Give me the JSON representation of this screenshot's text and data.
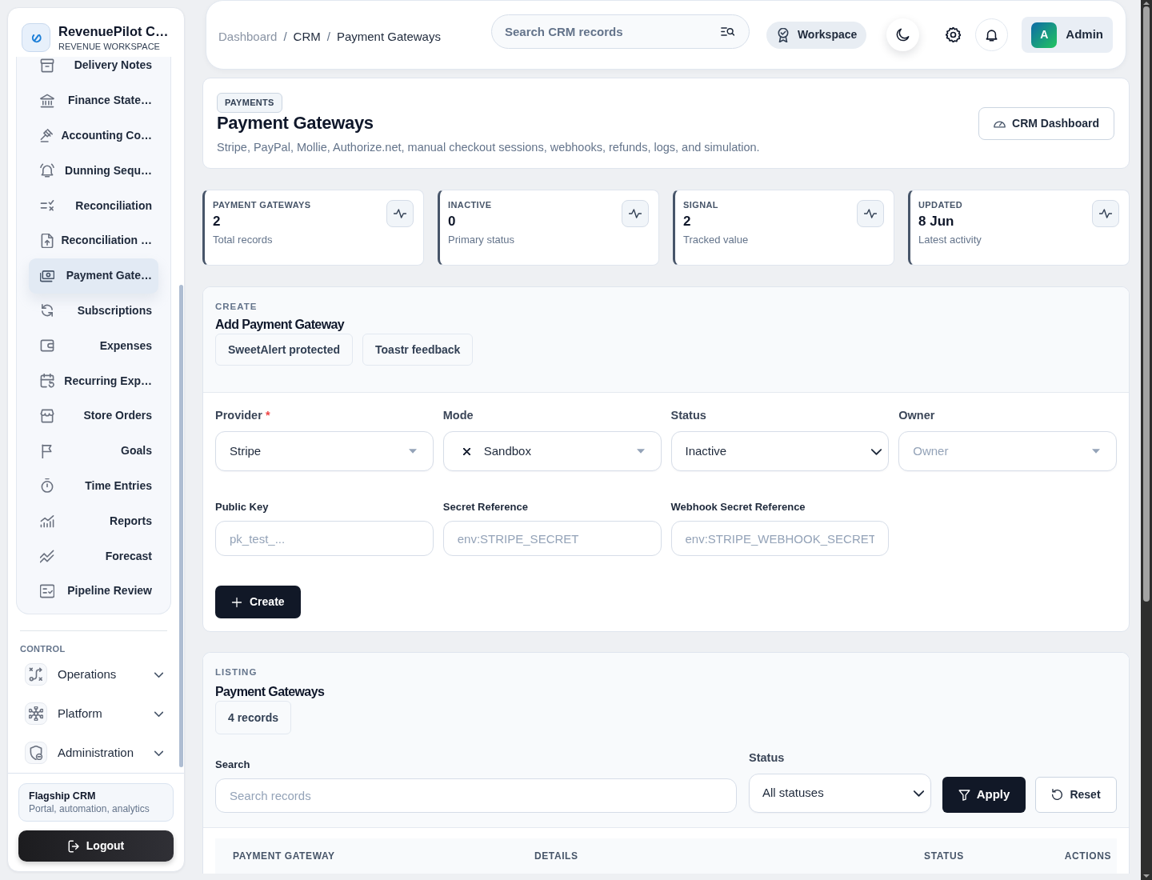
{
  "sidebar": {
    "brand": {
      "title": "RevenuePilot C…",
      "subtitle": "REVENUE WORKSPACE"
    },
    "nav_items": [
      {
        "label": "Delivery Notes",
        "selected": false
      },
      {
        "label": "Finance State…",
        "selected": false
      },
      {
        "label": "Accounting Co…",
        "selected": false
      },
      {
        "label": "Dunning Sequ…",
        "selected": false
      },
      {
        "label": "Reconciliation",
        "selected": false
      },
      {
        "label": "Reconciliation …",
        "selected": false
      },
      {
        "label": "Payment Gate…",
        "selected": true
      },
      {
        "label": "Subscriptions",
        "selected": false
      },
      {
        "label": "Expenses",
        "selected": false
      },
      {
        "label": "Recurring Exp…",
        "selected": false
      },
      {
        "label": "Store Orders",
        "selected": false
      },
      {
        "label": "Goals",
        "selected": false
      },
      {
        "label": "Time Entries",
        "selected": false
      },
      {
        "label": "Reports",
        "selected": false
      },
      {
        "label": "Forecast",
        "selected": false
      },
      {
        "label": "Pipeline Review",
        "selected": false
      }
    ],
    "section_label": "CONTROL",
    "groups": [
      {
        "label": "Operations",
        "expanded": false
      },
      {
        "label": "Platform",
        "expanded": false
      },
      {
        "label": "Administration",
        "expanded": false
      }
    ],
    "footer_card": {
      "title": "Flagship CRM",
      "subtitle": "Portal, automation, analytics"
    },
    "logout": "Logout"
  },
  "topbar": {
    "breadcrumbs": [
      {
        "label": "Dashboard",
        "muted": true
      },
      {
        "separator": "/",
        "label": "CRM",
        "muted": false
      },
      {
        "separator": "/",
        "label": "Payment Gateways",
        "muted": false
      }
    ],
    "search": {
      "placeholder": "Search CRM records"
    },
    "workspace": "Workspace",
    "user": {
      "initial": "A",
      "name": "Admin"
    }
  },
  "page_header": {
    "badge": "PAYMENTS",
    "title": "Payment Gateways",
    "description": "Stripe, PayPal, Mollie, Authorize.net, manual checkout sessions, webhooks, refunds, logs, and simulation.",
    "action": "CRM Dashboard"
  },
  "stats": [
    {
      "label": "PAYMENT GATEWAYS",
      "value": "2",
      "caption": "Total records"
    },
    {
      "label": "INACTIVE",
      "value": "0",
      "caption": "Primary status"
    },
    {
      "label": "SIGNAL",
      "value": "2",
      "caption": "Tracked value"
    },
    {
      "label": "UPDATED",
      "value": "8 Jun",
      "caption": "Latest activity"
    }
  ],
  "create_panel": {
    "eyebrow": "CREATE",
    "title": "Add Payment Gateway",
    "tags": [
      "SweetAlert protected",
      "Toastr feedback"
    ],
    "fields": [
      {
        "kind": "select2",
        "label": "Provider",
        "required_mark": "*",
        "value": "Stripe",
        "clearable": false
      },
      {
        "kind": "select2",
        "label": "Mode",
        "value": "Sandbox",
        "clearable": true
      },
      {
        "kind": "select",
        "label": "Status",
        "value": "Inactive"
      },
      {
        "kind": "select2",
        "label": "Owner",
        "placeholder": "Owner",
        "clearable": false
      },
      {
        "kind": "text",
        "label": "Public Key",
        "placeholder": "pk_test_..."
      },
      {
        "kind": "text",
        "label": "Secret Reference",
        "placeholder": "env:STRIPE_SECRET"
      },
      {
        "kind": "text",
        "label": "Webhook Secret Reference",
        "placeholder": "env:STRIPE_WEBHOOK_SECRET"
      }
    ],
    "submit": "Create"
  },
  "listing_panel": {
    "eyebrow": "LISTING",
    "title": "Payment Gateways",
    "count": "4 records",
    "filters": [
      {
        "kind": "text",
        "label": "Search",
        "placeholder": "Search records"
      },
      {
        "kind": "select",
        "label": "Status",
        "value": "All statuses"
      }
    ],
    "actions": [
      {
        "kind": "primary",
        "label": "Apply"
      },
      {
        "kind": "outline",
        "label": "Reset"
      }
    ],
    "table": {
      "columns": [
        "PAYMENT GATEWAY",
        "DETAILS",
        "STATUS",
        "ACTIONS"
      ]
    }
  }
}
